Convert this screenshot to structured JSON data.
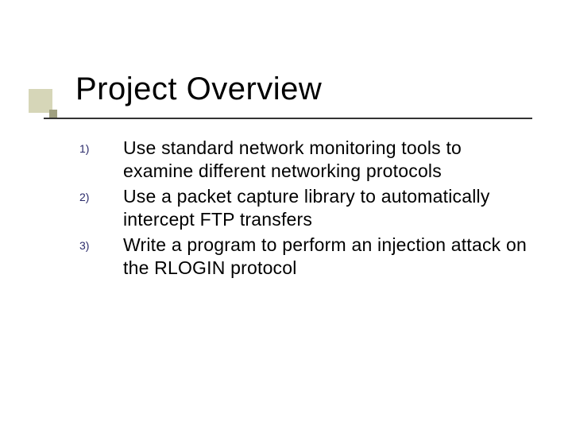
{
  "slide": {
    "title": "Project Overview",
    "items": [
      {
        "num": "1)",
        "text": "Use standard network monitoring tools to examine different networking protocols"
      },
      {
        "num": "2)",
        "text": "Use a packet capture library to automatically intercept FTP transfers"
      },
      {
        "num": "3)",
        "text": "Write a program to perform an injection attack on the RLOGIN protocol"
      }
    ]
  }
}
